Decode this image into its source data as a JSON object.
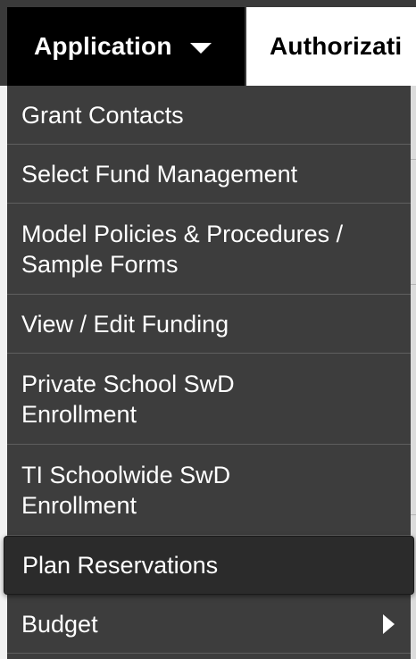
{
  "nav": {
    "items": [
      {
        "label": "Application"
      },
      {
        "label": "Authorizati"
      }
    ]
  },
  "menu": {
    "items": [
      {
        "label": "Grant Contacts"
      },
      {
        "label": "Select Fund Management"
      },
      {
        "label": "Model Policies & Procedures / Sample Forms"
      },
      {
        "label": "View / Edit Funding"
      },
      {
        "label": "Private School SwD Enrollment"
      },
      {
        "label": "TI Schoolwide SwD Enrollment"
      },
      {
        "label": "Plan Reservations"
      },
      {
        "label": "Budget"
      }
    ],
    "hovered_item": "Plan Reservations",
    "submenu_item": "Budget"
  },
  "colors": {
    "menu_bg": "#3d3d3d",
    "menu_hover_bg": "#2b2b2b",
    "nav_active_bg": "#000000",
    "nav_bg": "#ffffff",
    "text": "#ffffff",
    "divider": "#5f5f5f"
  },
  "icons": {
    "dropdown": "caret-down-icon",
    "submenu": "caret-right-icon"
  }
}
